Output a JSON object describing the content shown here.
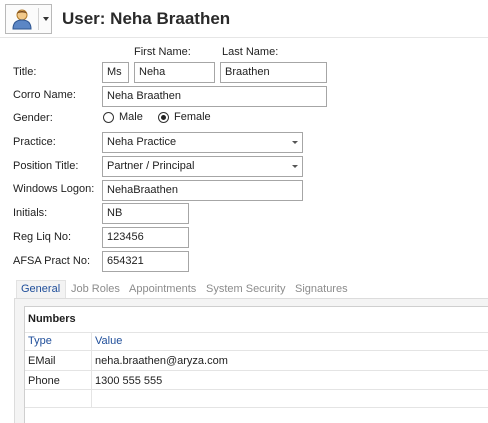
{
  "header": {
    "title": "User: Neha Braathen"
  },
  "form": {
    "first_name_label": "First Name:",
    "last_name_label": "Last Name:",
    "title_label": "Title:",
    "title_value": "Ms",
    "first_name_value": "Neha",
    "last_name_value": "Braathen",
    "corro_name_label": "Corro Name:",
    "corro_name_value": "Neha Braathen",
    "gender_label": "Gender:",
    "gender_options": [
      "Male",
      "Female"
    ],
    "gender_selected": "Female",
    "practice_label": "Practice:",
    "practice_value": "Neha Practice",
    "position_title_label": "Position Title:",
    "position_title_value": "Partner / Principal",
    "windows_logon_label": "Windows Logon:",
    "windows_logon_value": "NehaBraathen",
    "initials_label": "Initials:",
    "initials_value": "NB",
    "reg_liq_no_label": "Reg Liq No:",
    "reg_liq_no_value": "123456",
    "afsa_pract_no_label": "AFSA Pract No:",
    "afsa_pract_no_value": "654321"
  },
  "tabs": [
    "General",
    "Job Roles",
    "Appointments",
    "System Security",
    "Signatures"
  ],
  "active_tab": "General",
  "numbers": {
    "title": "Numbers",
    "columns": [
      "Type",
      "Value"
    ],
    "rows": [
      {
        "type": "EMail",
        "value": "neha.braathen@aryza.com"
      },
      {
        "type": "Phone",
        "value": "1300 555 555"
      }
    ]
  },
  "colors": {
    "accent": "#1f4e9a",
    "field_border": "#a6a6a6",
    "inactive_tab": "#8c8c8c"
  }
}
